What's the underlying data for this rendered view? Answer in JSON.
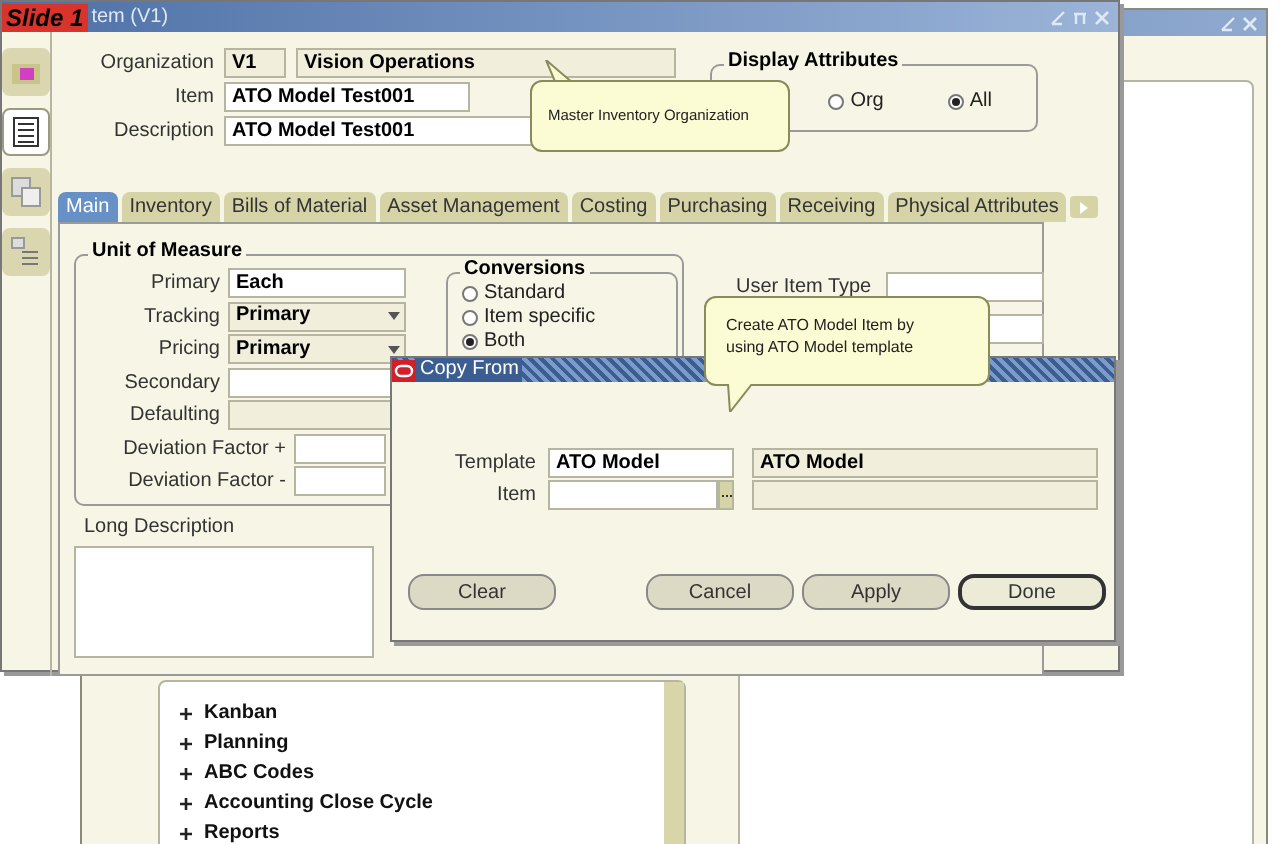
{
  "slide_label": "Slide 1",
  "back_window": {
    "tree": [
      {
        "label": "Kanban",
        "expanded": false
      },
      {
        "label": "Planning",
        "expanded": false
      },
      {
        "label": "ABC Codes",
        "expanded": false
      },
      {
        "label": "Accounting Close Cycle",
        "expanded": false
      },
      {
        "label": "Reports",
        "expanded": false
      }
    ]
  },
  "item_window": {
    "title": "tem (V1)",
    "side_tools": [
      {
        "kind": "folder",
        "selected": false
      },
      {
        "kind": "list",
        "selected": true
      },
      {
        "kind": "stack",
        "selected": false
      },
      {
        "kind": "outline",
        "selected": false
      }
    ],
    "organization": {
      "label": "Organization",
      "code": "V1",
      "name": "Vision Operations"
    },
    "item": {
      "label": "Item",
      "value": "ATO Model Test001"
    },
    "description": {
      "label": "Description",
      "value": "ATO Model Test001"
    },
    "display_attributes": {
      "title": "Display Attributes",
      "options": [
        {
          "label": "Org",
          "selected": false
        },
        {
          "label": "All",
          "selected": true
        }
      ]
    },
    "tabs": [
      {
        "label": "Main",
        "selected": true
      },
      {
        "label": "Inventory",
        "selected": false
      },
      {
        "label": "Bills of Material",
        "selected": false
      },
      {
        "label": "Asset Management",
        "selected": false
      },
      {
        "label": "Costing",
        "selected": false
      },
      {
        "label": "Purchasing",
        "selected": false
      },
      {
        "label": "Receiving",
        "selected": false
      },
      {
        "label": "Physical Attributes",
        "selected": false
      }
    ],
    "unit_of_measure": {
      "title": "Unit of Measure",
      "fields": [
        {
          "label": "Primary",
          "value": "Each",
          "kind": "text"
        },
        {
          "label": "Tracking",
          "value": "Primary",
          "kind": "dropdown"
        },
        {
          "label": "Pricing",
          "value": "Primary",
          "kind": "dropdown"
        },
        {
          "label": "Secondary",
          "kind": "text"
        },
        {
          "label": "Defaulting",
          "kind": "readonly"
        },
        {
          "label": "Deviation Factor +",
          "kind": "short"
        },
        {
          "label": "Deviation Factor -",
          "kind": "short"
        }
      ]
    },
    "conversions": {
      "title": "Conversions",
      "options": [
        {
          "label": "Standard",
          "selected": false
        },
        {
          "label": "Item specific",
          "selected": false
        },
        {
          "label": "Both",
          "selected": true
        }
      ]
    },
    "user_item_type": {
      "label": "User Item Type"
    },
    "long_description": {
      "label": "Long Description"
    }
  },
  "callouts": [
    {
      "text": "Master Inventory Organization"
    },
    {
      "text": "Create ATO Model Item by using ATO Model template"
    }
  ],
  "dialog": {
    "title": "Copy From",
    "template": {
      "label": "Template",
      "value": "ATO Model",
      "description": "ATO Model"
    },
    "item": {
      "label": "Item"
    },
    "buttons": [
      {
        "label": "Clear",
        "default": false
      },
      {
        "label": "Cancel",
        "default": false
      },
      {
        "label": "Apply",
        "default": false
      },
      {
        "label": "Done",
        "default": true
      }
    ]
  }
}
